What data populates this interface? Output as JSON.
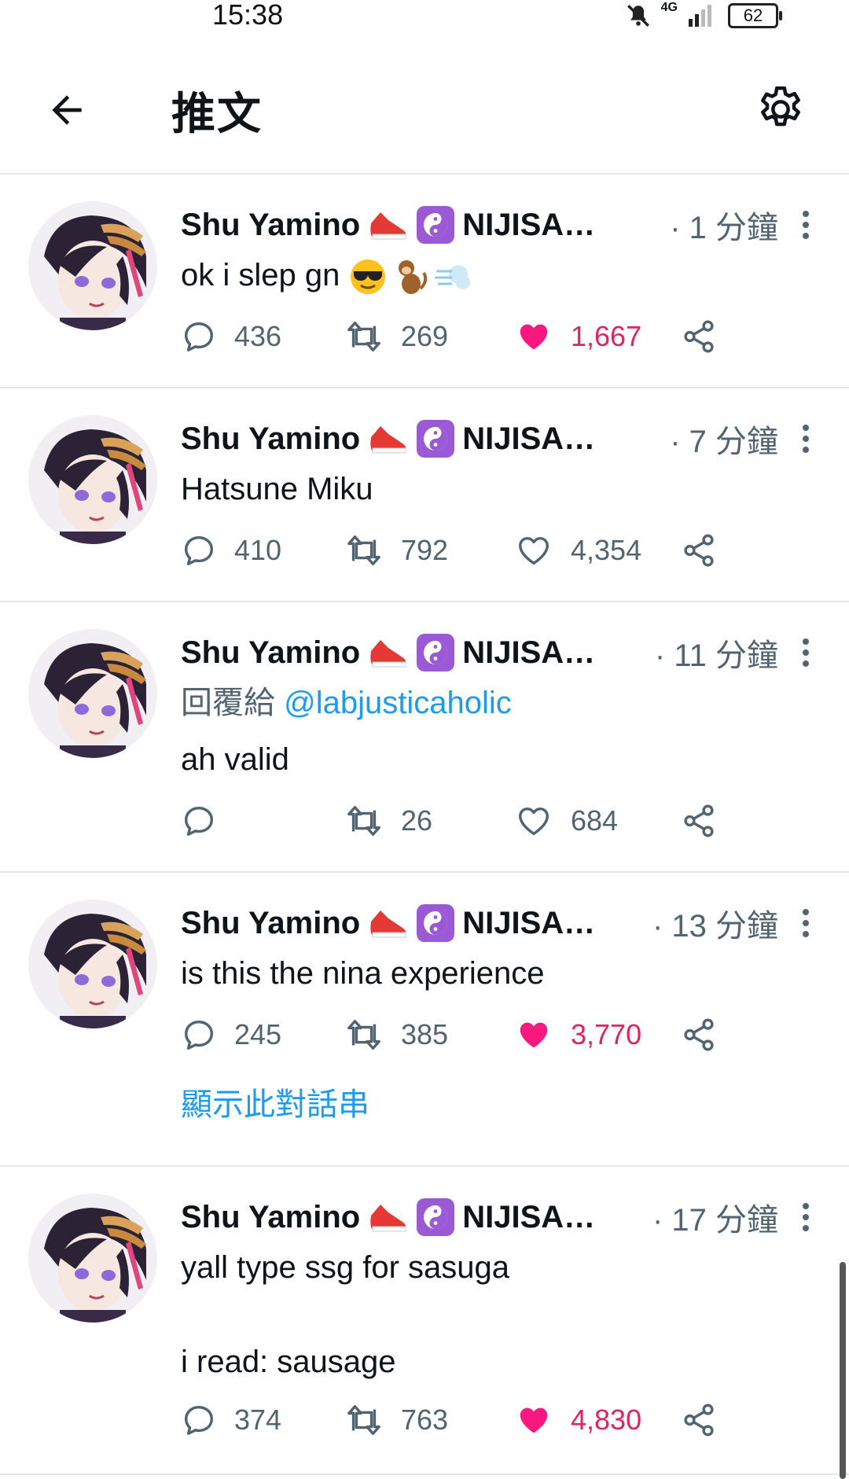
{
  "status_bar": {
    "time": "15:38",
    "network": "4G",
    "battery": "62"
  },
  "header": {
    "title": "推文"
  },
  "colors": {
    "link": "#1d9bf0",
    "like": "#e0245e",
    "muted": "#536471",
    "divider": "#e6e9ec"
  },
  "tweets": [
    {
      "name": "Shu Yamino",
      "handle": "NIJISA…",
      "time": "· 1 分鐘",
      "reply_label": "",
      "reply_handle": "",
      "text": "ok i slep gn",
      "emojis": [
        "sunglasses-emoji",
        "monkey-emoji",
        "dash-emoji"
      ],
      "replies": "436",
      "retweets": "269",
      "likes": "1,667",
      "liked": true,
      "thread_link": ""
    },
    {
      "name": "Shu Yamino",
      "handle": "NIJISA…",
      "time": "· 7 分鐘",
      "reply_label": "",
      "reply_handle": "",
      "text": "Hatsune Miku",
      "emojis": [],
      "replies": "410",
      "retweets": "792",
      "likes": "4,354",
      "liked": false,
      "thread_link": ""
    },
    {
      "name": "Shu Yamino",
      "handle": "NIJISA…",
      "time": "· 11 分鐘",
      "reply_label": "回覆給",
      "reply_handle": "@labjusticaholic",
      "text": "ah valid",
      "emojis": [],
      "replies": "",
      "retweets": "26",
      "likes": "684",
      "liked": false,
      "thread_link": ""
    },
    {
      "name": "Shu Yamino",
      "handle": "NIJISA…",
      "time": "· 13 分鐘",
      "reply_label": "",
      "reply_handle": "",
      "text": "is this the nina experience",
      "emojis": [],
      "replies": "245",
      "retweets": "385",
      "likes": "3,770",
      "liked": true,
      "thread_link": "顯示此對話串"
    },
    {
      "name": "Shu Yamino",
      "handle": "NIJISA…",
      "time": "· 17 分鐘",
      "reply_label": "",
      "reply_handle": "",
      "text": "yall type ssg for sasuga\n\ni read: sausage",
      "emojis": [],
      "replies": "374",
      "retweets": "763",
      "likes": "4,830",
      "liked": true,
      "thread_link": ""
    }
  ]
}
